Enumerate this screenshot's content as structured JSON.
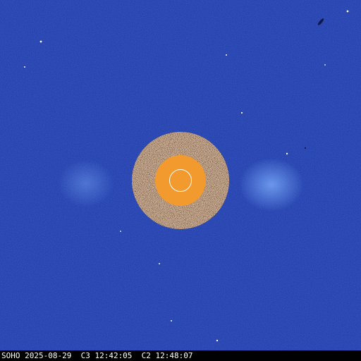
{
  "image": {
    "kind": "LASCO C3/C2 composite coronagraph",
    "caption": "SOHO 2025-08-29  C3 12:42:05  C2 12:48:07",
    "colors": {
      "background": "#1f3aa6",
      "occulter_outer": "#3a2a20",
      "occulter_inner": "#f29a2e",
      "sun_outline": "#ffffff",
      "caption_bg": "#000000",
      "caption_text": "#ffffff"
    }
  }
}
